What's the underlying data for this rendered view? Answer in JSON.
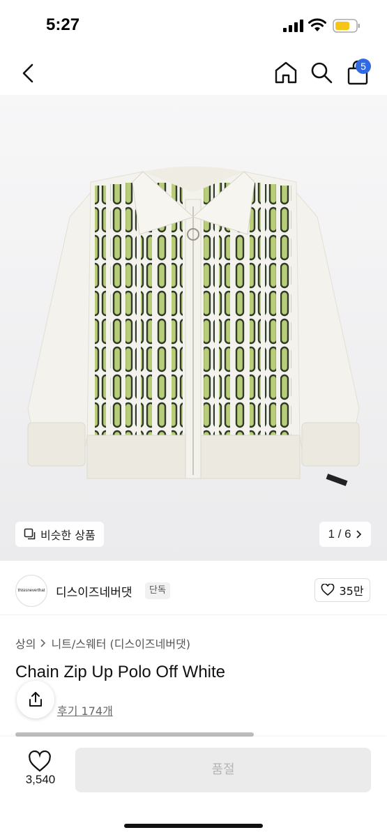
{
  "status_bar": {
    "time": "5:27"
  },
  "nav": {
    "cart_count": "5"
  },
  "gallery": {
    "similar_label": "비슷한 상품",
    "pager": "1 / 6"
  },
  "brand": {
    "logo_text": "thisisneverthat",
    "name": "디스이즈네버댓",
    "tag": "단독",
    "likes": "35만"
  },
  "product": {
    "breadcrumb": [
      "상의",
      "니트/스웨터 (디스이즈네버댓)"
    ],
    "title": "Chain Zip Up Polo Off White",
    "reviews": "후기 174개"
  },
  "bottom_bar": {
    "like_count": "3,540",
    "buy_label": "품절"
  },
  "colors": {
    "accent": "#2f6ae3",
    "chain_dark": "#2f3b2a",
    "chain_light": "#b9cc78",
    "knit": "#f4f2ec"
  }
}
